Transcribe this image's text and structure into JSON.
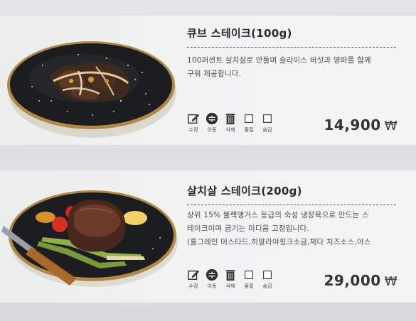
{
  "currency_symbol": "₩",
  "actions": {
    "edit": "수정",
    "move": "이동",
    "delete": "삭제",
    "soldout": "품절",
    "hide": "숨김"
  },
  "menu_items": [
    {
      "title": "큐브 스테이크(100g)",
      "desc_lines": [
        "100퍼센트 살치살로 만들며 슬라이스 버섯과 양파를 함께",
        "구워 제공합니다."
      ],
      "price": "14,900"
    },
    {
      "title": "살치살 스테이크(200g)",
      "desc_lines": [
        "상위 15% 블랙앵거스 등급의 숙성 냉장육으로 만드는 스",
        "테이크이며 굽기는 미디움 고정입니다.",
        "(홀그레인 머스타드,히말라야핑크소금,체다 치즈소스,아스"
      ],
      "price": "29,000"
    }
  ],
  "colors": {
    "plate": "#1c1d20",
    "plate_rim": "#b08a45",
    "text_dark": "#2a2a2a"
  }
}
